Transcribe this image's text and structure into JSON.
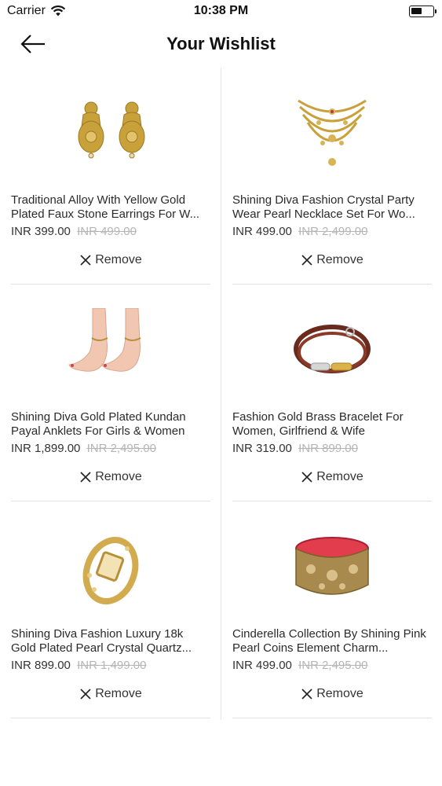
{
  "status_bar": {
    "carrier": "Carrier",
    "time": "10:38 PM"
  },
  "header": {
    "title": "Your Wishlist"
  },
  "remove_label": "Remove",
  "products": [
    {
      "name": "Traditional Alloy With Yellow Gold Plated Faux Stone Earrings For W...",
      "price": "INR 399.00",
      "mrp": "INR 499.00",
      "image": "earrings-icon"
    },
    {
      "name": "Shining Diva Fashion Crystal Party Wear Pearl Necklace Set For Wo...",
      "price": "INR 499.00",
      "mrp": "INR 2,499.00",
      "image": "necklace-icon"
    },
    {
      "name": "Shining Diva Gold Plated Kundan Payal Anklets For Girls & Women",
      "price": "INR 1,899.00",
      "mrp": "INR 2,495.00",
      "image": "anklets-icon"
    },
    {
      "name": "Fashion Gold Brass Bracelet For Women, Girlfriend & Wife",
      "price": "INR 319.00",
      "mrp": "INR 899.00",
      "image": "bracelet-icon"
    },
    {
      "name": "Shining Diva Fashion Luxury 18k Gold Plated Pearl Crystal Quartz...",
      "price": "INR 899.00",
      "mrp": "INR 1,499.00",
      "image": "watch-icon"
    },
    {
      "name": "Cinderella Collection By Shining Pink Pearl Coins Element Charm...",
      "price": "INR 499.00",
      "mrp": "INR 2,495.00",
      "image": "bangle-icon"
    }
  ]
}
